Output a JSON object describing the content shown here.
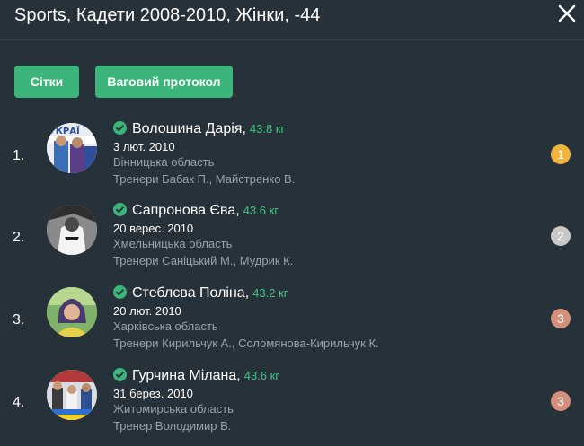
{
  "header": {
    "title": "Sports, Кадети 2008-2010, Жінки, -44"
  },
  "buttons": {
    "grids": "Сітки",
    "weigh_protocol": "Ваговий протокол"
  },
  "colors": {
    "accent": "#3bb57a",
    "background": "#263139",
    "gold": "#f0b440",
    "silver": "#c8c8c8",
    "bronze": "#d4907c"
  },
  "entries": [
    {
      "place": "1.",
      "name": "Волошина Дарія",
      "weight": "43.8 кг",
      "dob": "3 лют. 2010",
      "region": "Вінницька область",
      "coaches": "Тренери Бабак П.,  Майстренко В.",
      "medal": "1",
      "avatar_text": "УКРАЇ"
    },
    {
      "place": "2.",
      "name": "Сапронова Єва",
      "weight": "43.6 кг",
      "dob": "20 верес. 2010",
      "region": "Хмельницька область",
      "coaches": "Тренери Саніцький М.,  Мудрик К.",
      "medal": "2"
    },
    {
      "place": "3.",
      "name": "Стеблєва Поліна",
      "weight": "43.2 кг",
      "dob": "20 лют. 2010",
      "region": "Харківська область",
      "coaches": "Тренери Кирильчук А.,  Соломянова-Кирильчук К.",
      "medal": "3"
    },
    {
      "place": "4.",
      "name": "Гурчина Мілана",
      "weight": "43.6 кг",
      "dob": "31 берез. 2010",
      "region": "Житомирська область",
      "coaches": "Тренер Володимир В.",
      "medal": "3"
    }
  ]
}
